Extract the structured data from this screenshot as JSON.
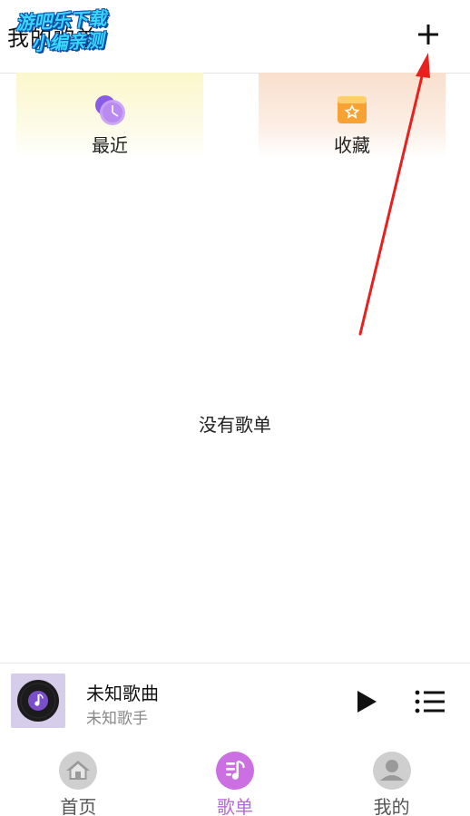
{
  "header": {
    "title": "我的歌单",
    "add_icon": "plus-icon"
  },
  "watermark": {
    "line1": "游吧乐下载",
    "line2": "小编亲测"
  },
  "quick_cards": [
    {
      "label": "最近",
      "icon": "recent-clock-icon",
      "color": "#9b59e8"
    },
    {
      "label": "收藏",
      "icon": "favorite-star-icon",
      "color": "#f5a23a"
    }
  ],
  "empty_state": {
    "text": "没有歌单"
  },
  "player": {
    "title": "未知歌曲",
    "artist": "未知歌手",
    "play_icon": "play-icon",
    "playlist_icon": "playlist-icon"
  },
  "nav": {
    "items": [
      {
        "label": "首页",
        "icon": "home-icon"
      },
      {
        "label": "歌单",
        "icon": "music-note-icon"
      },
      {
        "label": "我的",
        "icon": "user-icon"
      }
    ],
    "active_index": 1,
    "active_color": "#b46ad8"
  }
}
